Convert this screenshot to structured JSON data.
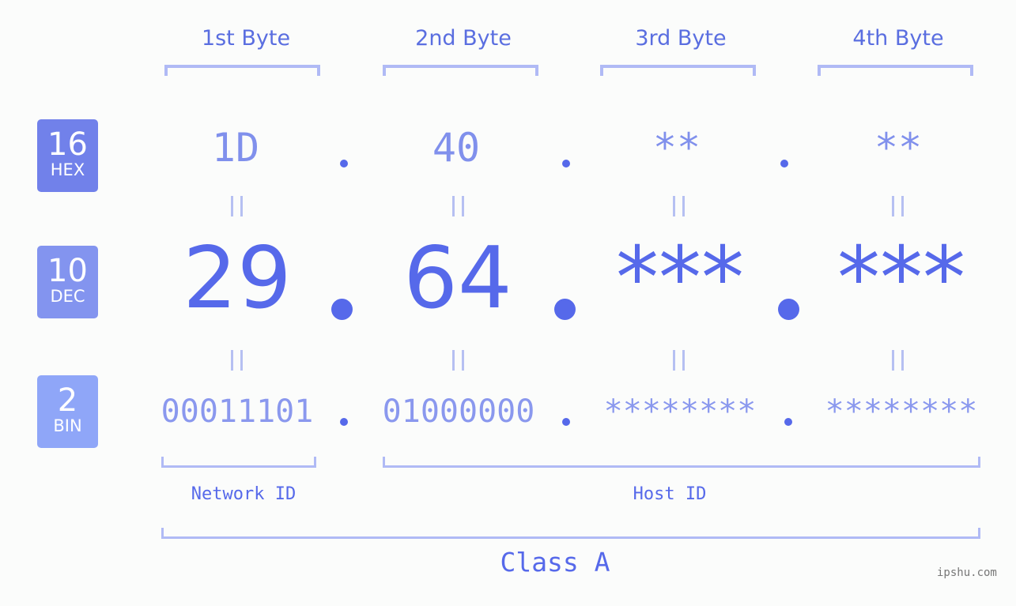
{
  "bytes": [
    {
      "header": "1st Byte",
      "hex": "1D",
      "dec": "29",
      "bin": "00011101"
    },
    {
      "header": "2nd Byte",
      "hex": "40",
      "dec": "64",
      "bin": "01000000"
    },
    {
      "header": "3rd Byte",
      "hex": "**",
      "dec": "***",
      "bin": "********"
    },
    {
      "header": "4th Byte",
      "hex": "**",
      "dec": "***",
      "bin": "********"
    }
  ],
  "badges": {
    "hex": {
      "number": "16",
      "label": "HEX",
      "color": "#7181ea"
    },
    "dec": {
      "number": "10",
      "label": "DEC",
      "color": "#8394ef"
    },
    "bin": {
      "number": "2",
      "label": "BIN",
      "color": "#8fa6f8"
    }
  },
  "labels": {
    "network_id": "Network ID",
    "host_id": "Host ID",
    "class": "Class A"
  },
  "watermark": "ipshu.com",
  "colors": {
    "accent": "#5669ea",
    "bracket": "#b0baf5"
  }
}
